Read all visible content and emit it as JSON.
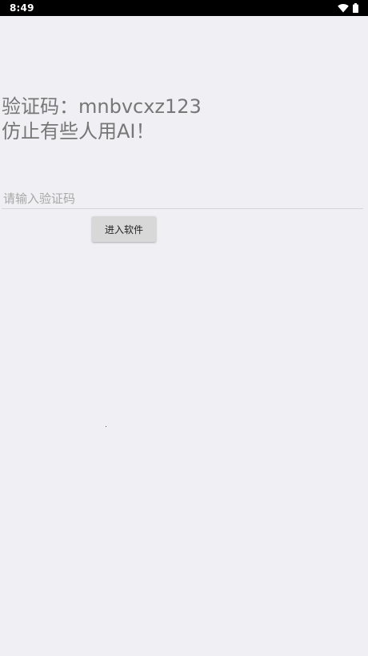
{
  "status_bar": {
    "time": "8:49",
    "icons": [
      "wifi-icon",
      "battery-icon"
    ]
  },
  "main": {
    "captcha_line": "验证码：mnbvcxz123",
    "warning_line": "仿止有些人用AI！",
    "input": {
      "value": "",
      "placeholder": "请输入验证码"
    },
    "enter_button_label": "进入软件"
  },
  "colors": {
    "background": "#efeff4",
    "status_bar": "#000000",
    "headline_text": "#777777",
    "placeholder_text": "#a8a8a8",
    "button_background": "#d8d8d8"
  }
}
